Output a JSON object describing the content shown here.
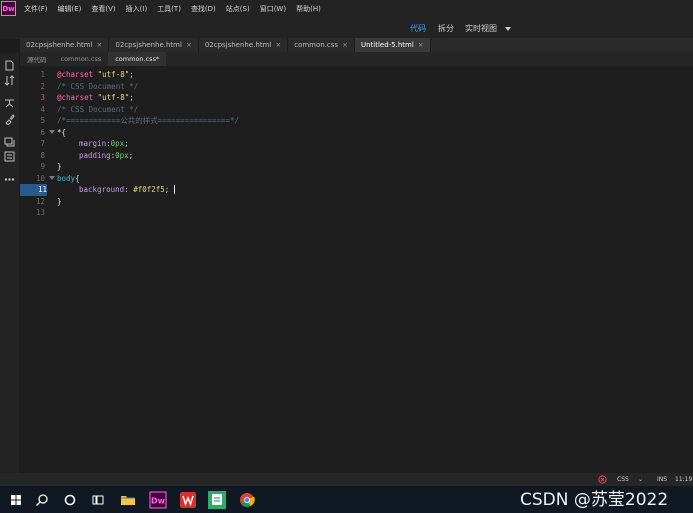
{
  "app": {
    "logo_text": "Dw"
  },
  "menu": [
    "文件(F)",
    "编辑(E)",
    "查看(V)",
    "插入(I)",
    "工具(T)",
    "查找(D)",
    "站点(S)",
    "窗口(W)",
    "帮助(H)"
  ],
  "views": {
    "code": "代码",
    "split": "拆分",
    "live": "实时视图"
  },
  "doc_tabs": [
    {
      "label": "02cpsjshenhe.html",
      "close": "×"
    },
    {
      "label": "02cpsjshenhe.html",
      "close": "×"
    },
    {
      "label": "02cpsjshenhe.html",
      "close": "×"
    },
    {
      "label": "common.css",
      "close": "×"
    },
    {
      "label": "Untitled-5.html",
      "close": "×"
    }
  ],
  "sub_tabs": [
    "源代码",
    "common.css",
    "common.css*"
  ],
  "line_numbers": [
    "1",
    "2",
    "3",
    "4",
    "5",
    "6",
    "7",
    "8",
    "9",
    "10",
    "11",
    "12",
    "13"
  ],
  "code": {
    "l1_kw": "@charset",
    "l1_str": " \"utf-8\"",
    "l1_end": ";",
    "l2": "/* CSS Document */",
    "l3_kw": "@charset",
    "l3_str": " \"utf-8\"",
    "l3_end": ";",
    "l4": "/* CSS Document */",
    "l5": "/*============公共的样式================*/",
    "l6": "*{",
    "l7_prop": "margin",
    "l7_colon": ":",
    "l7_val": "0px",
    "l7_end": ";",
    "l8_prop": "padding",
    "l8_colon": ":",
    "l8_val": "0px",
    "l8_end": ";",
    "l9": "}",
    "l10_tag": "body",
    "l10_brace": "{",
    "l11_prop": "background",
    "l11_colon": ": ",
    "l11_val": "#f0f2f5",
    "l11_end": ";",
    "l12": "}"
  },
  "status": {
    "lang": "CSS",
    "mode": "INS",
    "pos": "11:19"
  },
  "watermark": "CSDN @苏莹2022"
}
